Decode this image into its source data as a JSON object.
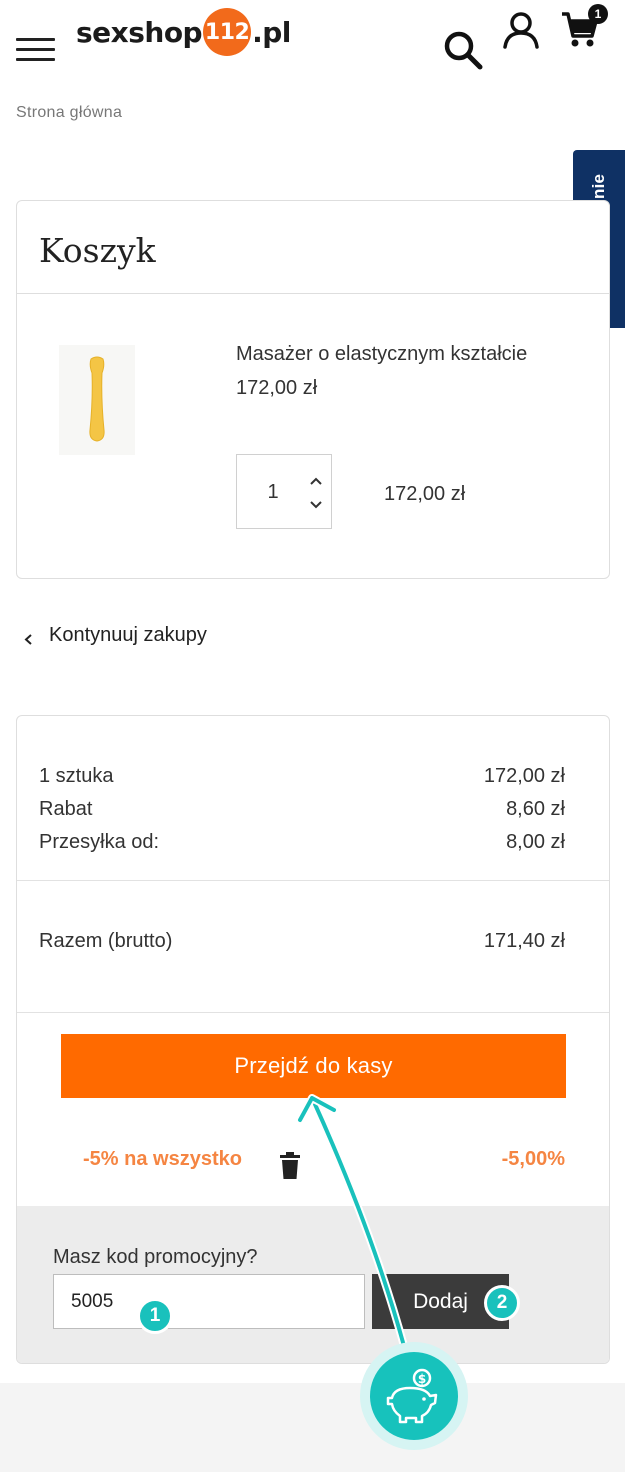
{
  "header": {
    "logo": {
      "text_before": "sexshop",
      "badge": "112",
      "text_after": ".pl"
    },
    "icons": {
      "menu": "hamburger-menu-icon",
      "search": "search-icon",
      "account": "user-icon",
      "cart": "cart-icon"
    },
    "cart_count": "1",
    "brand_color": "#f26a1b"
  },
  "breadcrumb": "Strona główna",
  "reviews_tab": "Sprawdź Opinie",
  "cart": {
    "title": "Koszyk",
    "items": [
      {
        "name": "Masażer o elastycznym kształcie",
        "unit_price": "172,00 zł",
        "quantity": "1",
        "total": "172,00 zł"
      }
    ]
  },
  "continue_shopping": "Kontynuuj zakupy",
  "summary": {
    "rows": [
      {
        "label": "1 sztuka",
        "value": "172,00 zł"
      },
      {
        "label": "Rabat",
        "value": "8,60 zł"
      },
      {
        "label": "Przesyłka od:",
        "value": "8,00 zł"
      }
    ],
    "total": {
      "label": "Razem (brutto)",
      "value": "171,40 zł"
    },
    "checkout_button": "Przejdź do kasy",
    "applied_promo": {
      "name": "-5% na wszystko",
      "value": "-5,00%"
    },
    "promo_code": {
      "label": "Masz kod promocyjny?",
      "value": "5005",
      "button": "Dodaj"
    }
  },
  "annotations": {
    "step1": "1",
    "step2": "2",
    "accent_color": "#19c1bc",
    "piggy_icon": "piggy-bank-icon"
  },
  "colors": {
    "checkout": "#ff6a00",
    "promo_text": "#f58542",
    "reviews_tab": "#0f3164"
  }
}
